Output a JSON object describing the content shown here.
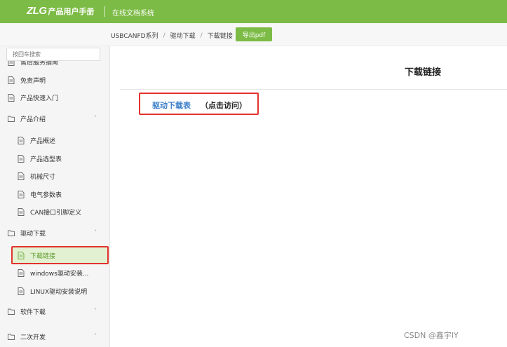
{
  "header": {
    "logo": "ZLG",
    "manual_title": "产品用户手册",
    "system_title": "在线文档系统"
  },
  "breadcrumb": {
    "items": [
      "USBCANFD系列",
      "驱动下载",
      "下载链接"
    ],
    "separator": "/",
    "export_label": "导出pdf"
  },
  "sidebar": {
    "search_placeholder": "按回车搜索",
    "items": [
      {
        "label": "售后服务指南",
        "icon": "document-icon"
      },
      {
        "label": "免责声明",
        "icon": "document-icon"
      },
      {
        "label": "产品快速入门",
        "icon": "document-icon"
      },
      {
        "label": "产品介绍",
        "icon": "folder-icon",
        "chevron": "˄"
      },
      {
        "label": "产品概述",
        "icon": "document-icon"
      },
      {
        "label": "产品选型表",
        "icon": "document-icon"
      },
      {
        "label": "机械尺寸",
        "icon": "document-icon"
      },
      {
        "label": "电气参数表",
        "icon": "document-icon"
      },
      {
        "label": "CAN接口引脚定义",
        "icon": "document-icon"
      },
      {
        "label": "驱动下载",
        "icon": "folder-icon",
        "chevron": "˄"
      },
      {
        "label": "下载链接",
        "icon": "document-icon",
        "active": true
      },
      {
        "label": "windows驱动安装...",
        "icon": "document-icon"
      },
      {
        "label": "LINUX驱动安装说明",
        "icon": "document-icon"
      },
      {
        "label": "软件下载",
        "icon": "folder-icon",
        "chevron": "˅"
      },
      {
        "label": "二次开发",
        "icon": "folder-icon",
        "chevron": "˅"
      }
    ]
  },
  "content": {
    "title": "下载链接",
    "link_label": "驱动下载表",
    "link_note": "（点击访问）"
  },
  "watermark": "CSDN @鑫宇lY",
  "colors": {
    "brand_green": "#7cbb45",
    "active_bg": "#e3f1d3",
    "highlight_red": "#e2322c",
    "link_blue": "#3a7ec9"
  }
}
